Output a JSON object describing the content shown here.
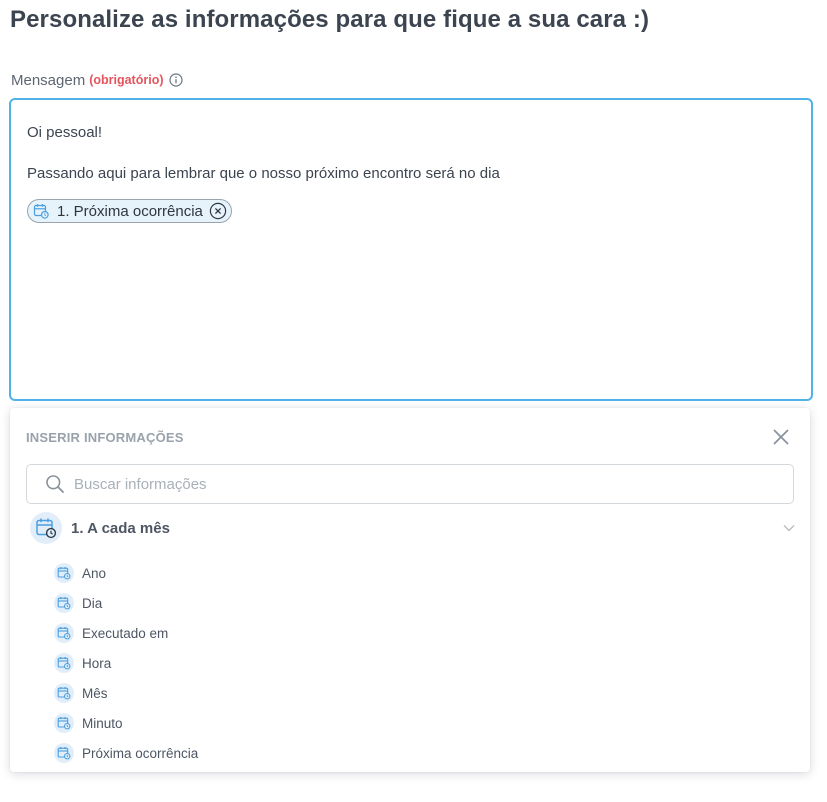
{
  "page": {
    "title": "Personalize as informações para que fique a sua cara :)"
  },
  "field": {
    "label": "Mensagem",
    "required": "(obrigatório)",
    "info_icon": "info-circle-icon"
  },
  "editor": {
    "line1": "Oi pessoal!",
    "line2": "Passando aqui para lembrar que o nosso próximo encontro será no dia",
    "chip": {
      "label": "1. Próxima ocorrência",
      "icon": "calendar-clock-icon",
      "remove_icon": "close-circle-icon"
    },
    "border_color": "#4fb3e8"
  },
  "panel": {
    "title": "INSERIR INFORMAÇÕES",
    "close_icon": "close-icon",
    "search": {
      "placeholder": "Buscar informações",
      "value": ""
    },
    "group": {
      "label": "1. A cada mês",
      "icon": "calendar-clock-icon",
      "chevron": "chevron-down-icon",
      "items": [
        {
          "label": "Ano"
        },
        {
          "label": "Dia"
        },
        {
          "label": "Executado em"
        },
        {
          "label": "Hora"
        },
        {
          "label": "Mês"
        },
        {
          "label": "Minuto"
        },
        {
          "label": "Próxima ocorrência"
        }
      ]
    }
  },
  "colors": {
    "accent": "#4fb3e8",
    "required": "#e4545d",
    "icon_blue": "#4a9fe0",
    "icon_bg": "#e1eefa"
  }
}
